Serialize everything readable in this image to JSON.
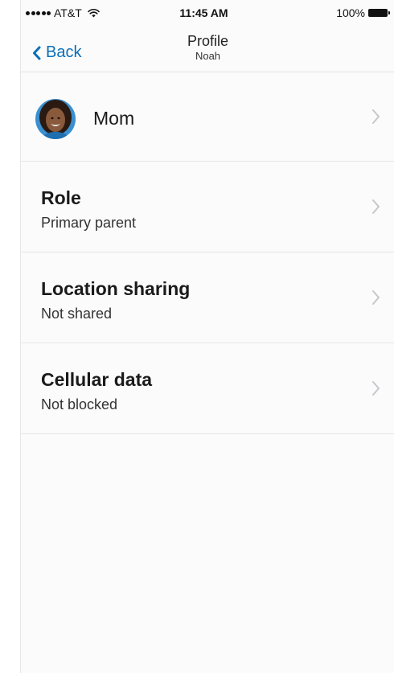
{
  "status_bar": {
    "carrier": "AT&T",
    "time": "11:45 AM",
    "battery": "100%"
  },
  "nav": {
    "back_label": "Back",
    "title": "Profile",
    "subtitle": "Noah"
  },
  "contact": {
    "name": "Mom"
  },
  "rows": [
    {
      "title": "Role",
      "value": "Primary parent"
    },
    {
      "title": "Location sharing",
      "value": "Not shared"
    },
    {
      "title": "Cellular data",
      "value": "Not blocked"
    }
  ],
  "colors": {
    "accent": "#0a6fb8",
    "divider": "#e6e6e6",
    "chevron": "#c7c7cc"
  },
  "icons": {
    "back": "chevron-left-icon",
    "disclosure": "chevron-right-icon",
    "signal": "signal-dots-icon",
    "wifi": "wifi-icon",
    "battery": "battery-icon"
  }
}
